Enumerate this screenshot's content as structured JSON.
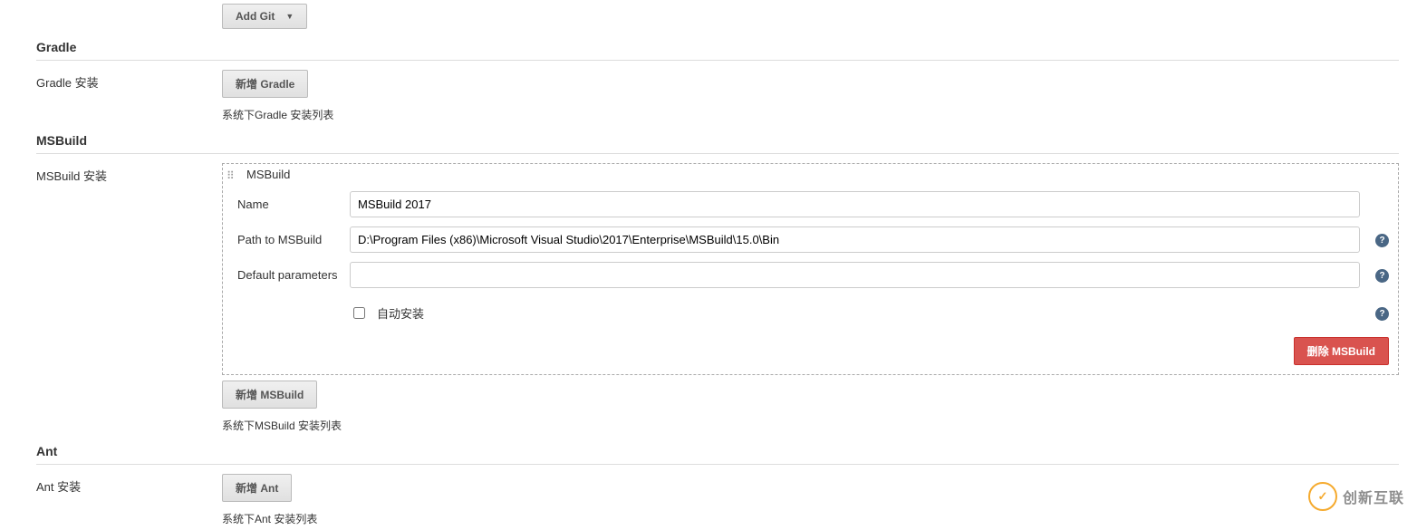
{
  "addGit": {
    "label": "Add Git"
  },
  "gradle": {
    "heading": "Gradle",
    "install_label": "Gradle 安装",
    "add_button": "新增 Gradle",
    "desc": "系统下Gradle 安装列表"
  },
  "msbuild": {
    "heading": "MSBuild",
    "install_label": "MSBuild 安装",
    "box_title": "MSBuild",
    "name_label": "Name",
    "name_value": "MSBuild 2017",
    "path_label": "Path to MSBuild",
    "path_value": "D:\\Program Files (x86)\\Microsoft Visual Studio\\2017\\Enterprise\\MSBuild\\15.0\\Bin",
    "default_params_label": "Default parameters",
    "default_params_value": "",
    "auto_install_label": "自动安装",
    "delete_button": "删除 MSBuild",
    "add_button": "新增 MSBuild",
    "desc": "系统下MSBuild 安装列表"
  },
  "ant": {
    "heading": "Ant",
    "install_label": "Ant 安装",
    "add_button": "新增 Ant",
    "desc": "系统下Ant 安装列表"
  },
  "watermark": "创新互联"
}
